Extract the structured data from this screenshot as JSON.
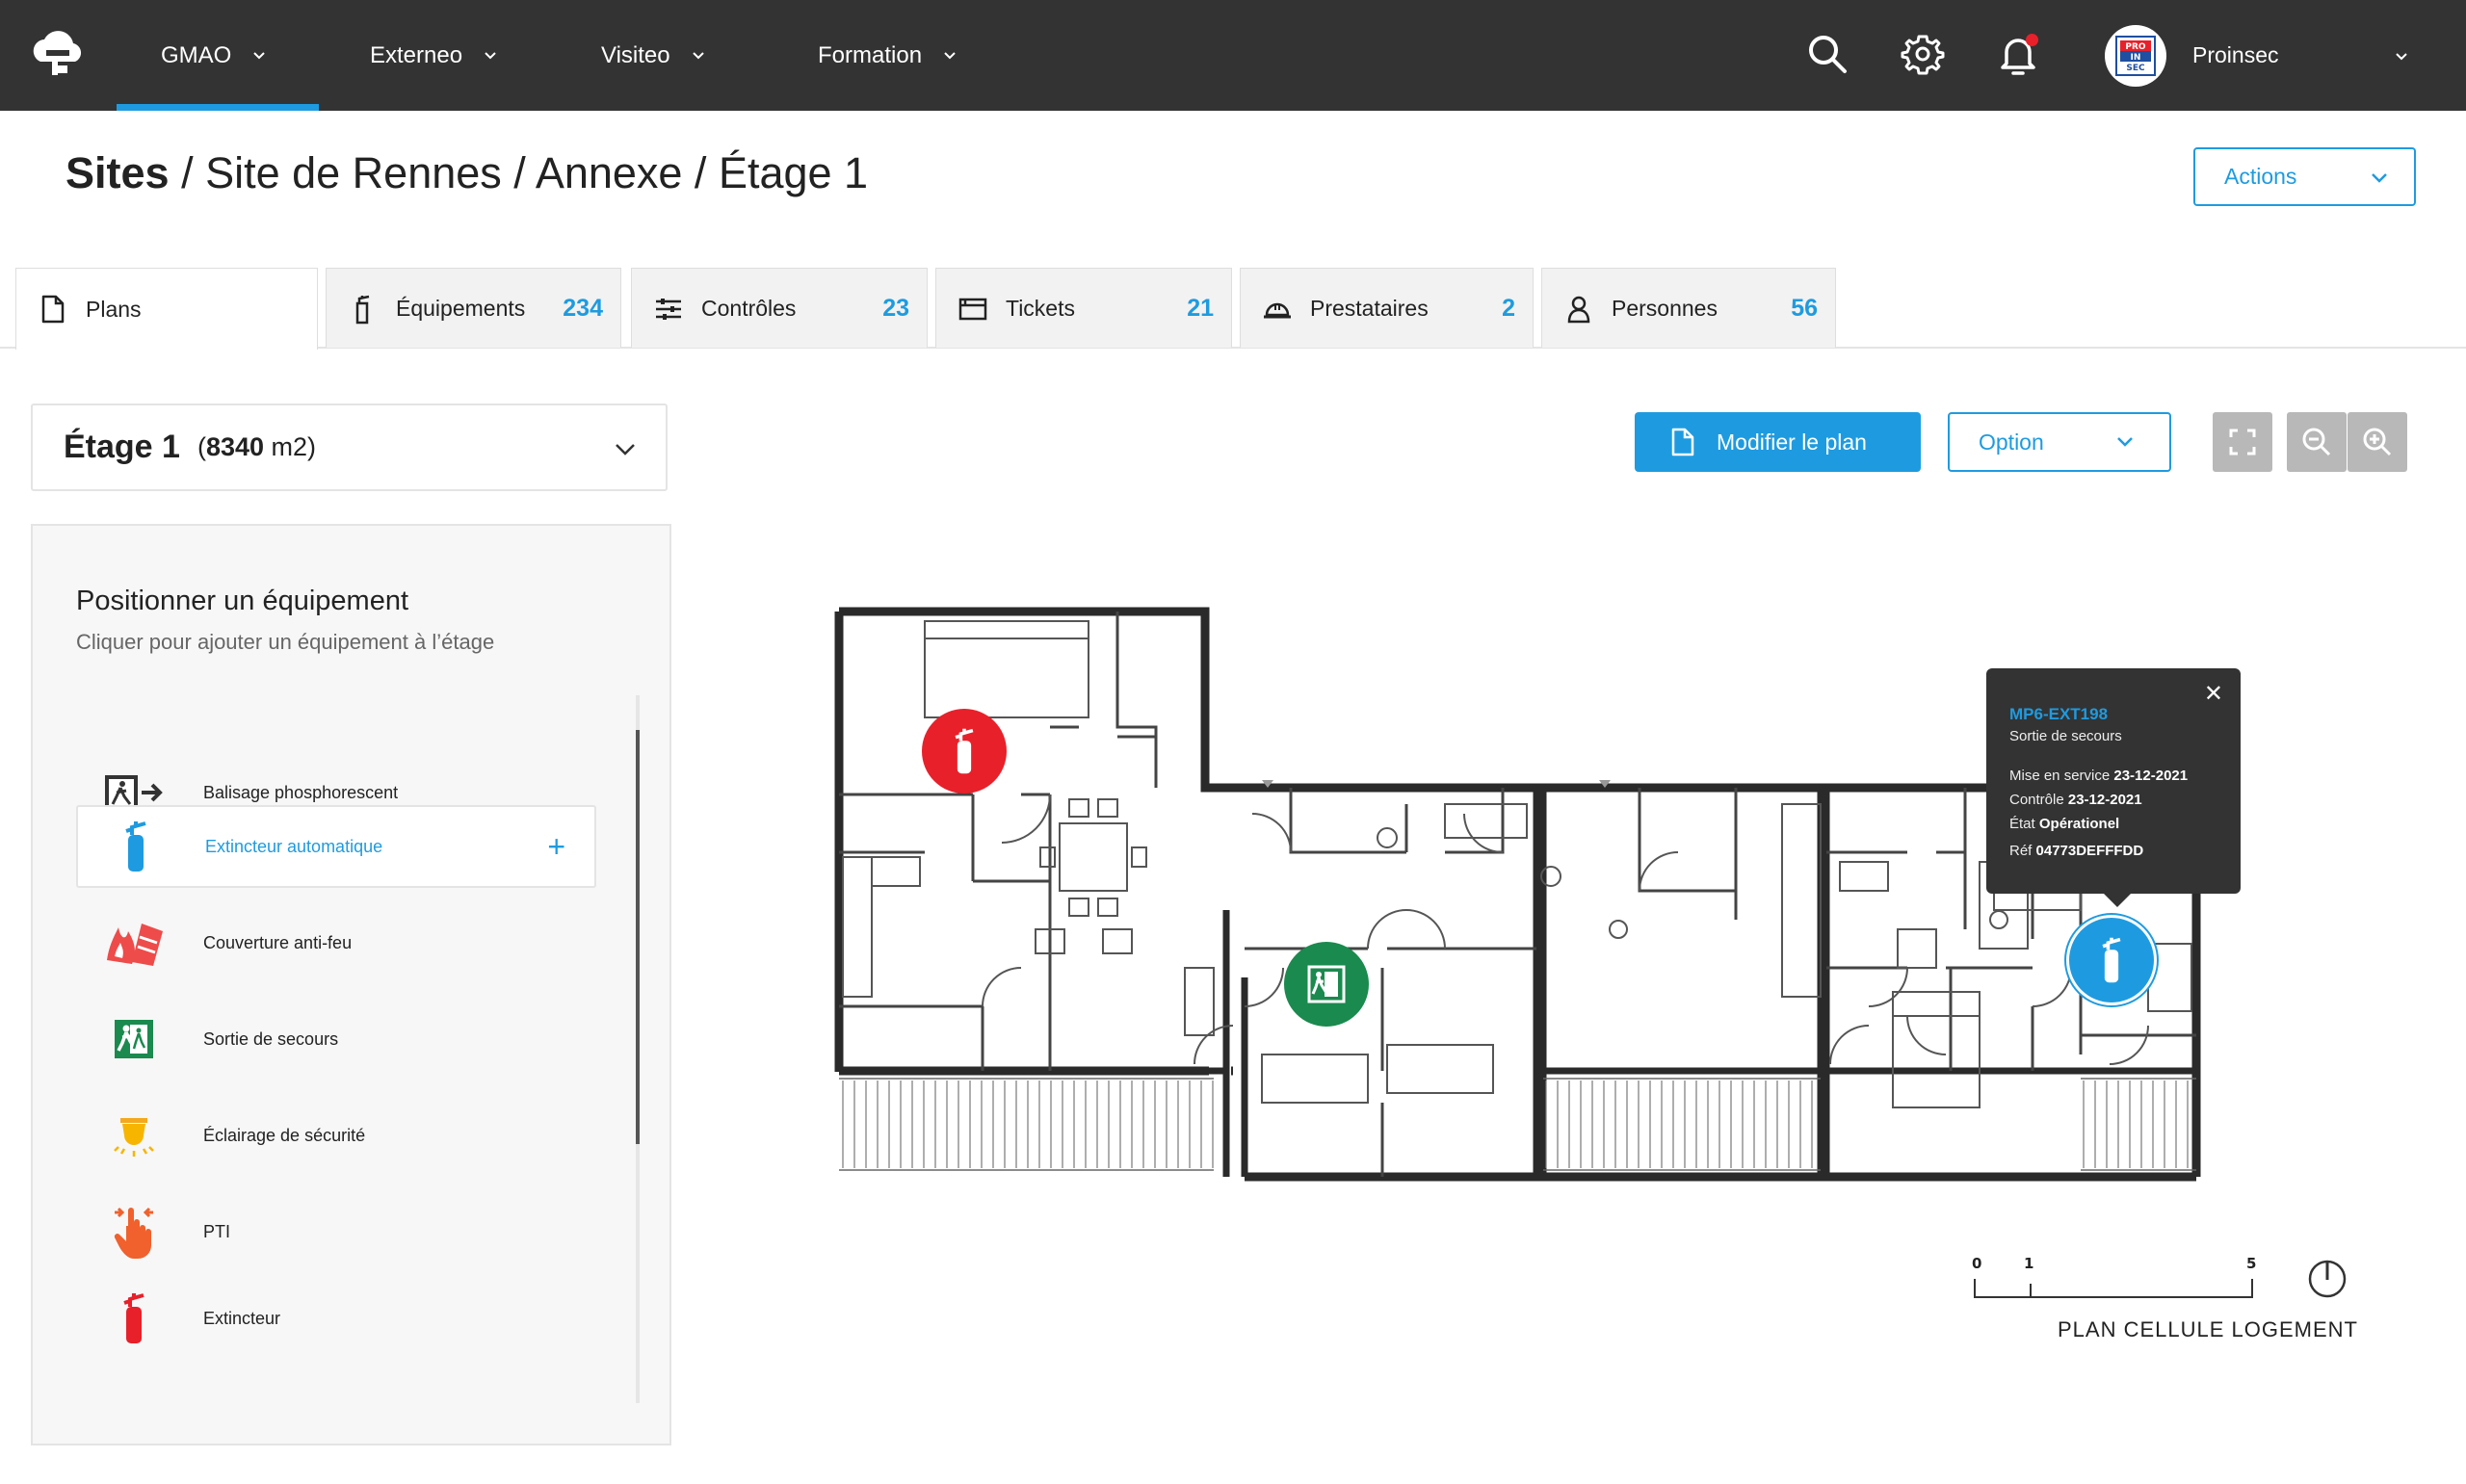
{
  "nav": {
    "items": [
      {
        "label": "GMAO"
      },
      {
        "label": "Externeo"
      },
      {
        "label": "Visiteo"
      },
      {
        "label": "Formation"
      }
    ],
    "user": {
      "name": "Proinsec",
      "avatar_text": "PRO IN SEC"
    }
  },
  "breadcrumb": {
    "root": "Sites",
    "path": "/ Site de Rennes / Annexe  / Étage 1"
  },
  "actions_label": "Actions",
  "tabs": [
    {
      "label": "Plans",
      "count": ""
    },
    {
      "label": "Équipements",
      "count": "234"
    },
    {
      "label": "Contrôles",
      "count": "23"
    },
    {
      "label": "Tickets",
      "count": "21"
    },
    {
      "label": "Prestataires",
      "count": "2"
    },
    {
      "label": "Personnes",
      "count": "56"
    }
  ],
  "floor": {
    "name": "Étage 1",
    "area_open": "(",
    "area_value": "8340",
    "area_unit": " m2)"
  },
  "panel": {
    "title": "Positionner un équipement",
    "subtitle": "Cliquer pour ajouter un équipement à l’étage",
    "items": [
      {
        "label": "Balisage phosphorescent",
        "icon": "exit-arrow-sign-icon"
      },
      {
        "label": "Extincteur automatique",
        "icon": "auto-extinguisher-icon"
      },
      {
        "label": "Couverture anti-feu",
        "icon": "fire-blanket-icon"
      },
      {
        "label": "Sortie de secours",
        "icon": "emergency-exit-icon"
      },
      {
        "label": "Éclairage de sécurité",
        "icon": "safety-light-icon"
      },
      {
        "label": "PTI",
        "icon": "pti-hand-icon"
      },
      {
        "label": "Extincteur",
        "icon": "extinguisher-icon"
      }
    ],
    "add_symbol": "+"
  },
  "toolbar": {
    "edit_plan": "Modifier le plan",
    "option": "Option"
  },
  "popup": {
    "id": "MP6-EXT198",
    "type": "Sortie de secours",
    "service_label": "Mise en service ",
    "service_value": "23-12-2021",
    "control_label": "Contrôle ",
    "control_value": "23-12-2021",
    "state_label": "État ",
    "state_value": "Opérationel",
    "ref_label": "Réf ",
    "ref_value": "04773DEFFFDD",
    "close": "✕"
  },
  "scale": {
    "t0": "0",
    "t1": "1",
    "t5": "5",
    "title": "PLAN CELLULE LOGEMENT"
  },
  "colors": {
    "accent": "#1e9be0",
    "topbar": "#333333",
    "red": "#e8202a",
    "green": "#1a8a4e"
  }
}
